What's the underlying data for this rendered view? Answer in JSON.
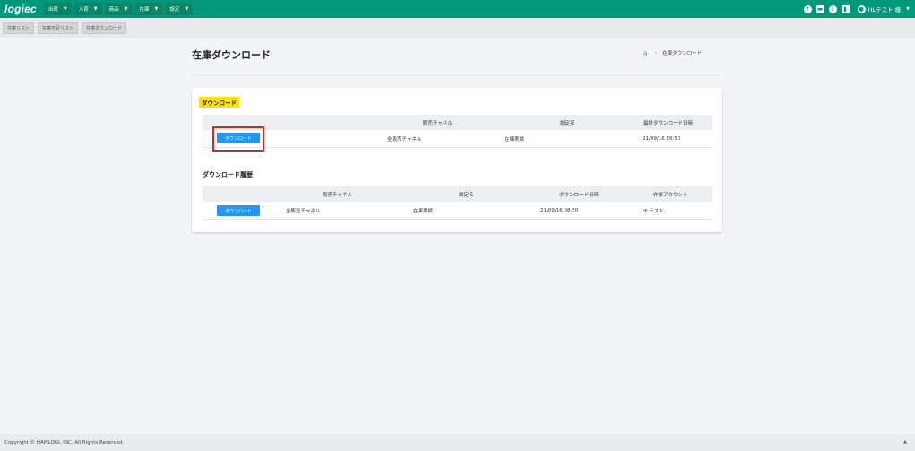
{
  "app": {
    "logo": "logiec"
  },
  "nav": {
    "menus": [
      {
        "label": "出荷"
      },
      {
        "label": "入荷"
      },
      {
        "label": "商品"
      },
      {
        "label": "在庫"
      },
      {
        "label": "設定"
      }
    ],
    "user_label": "HLテスト 様"
  },
  "subtabs": [
    "在庫リスト",
    "在庫不足リスト",
    "在庫ダウンロード"
  ],
  "page": {
    "title": "在庫ダウンロード",
    "breadcrumb_current": "在庫ダウンロード"
  },
  "download_section": {
    "badge": "ダウンロード",
    "headers": [
      "販売チャネル",
      "設定名",
      "最終ダウンロード日時"
    ],
    "rows": [
      {
        "button": "ダウンロード",
        "channel": "全販売チャネル",
        "setting": "在庫実績",
        "last_download": "21/09/16 08:50"
      }
    ]
  },
  "history_section": {
    "title": "ダウンロード履歴",
    "headers": [
      "販売チャネル",
      "設定名",
      "ダウンロード日時",
      "作業アカウント"
    ],
    "rows": [
      {
        "button": "ダウンロード",
        "channel": "全販売チャネル",
        "setting": "在庫実績",
        "downloaded_at": "21/09/16 08:50",
        "account": "HLテスト"
      }
    ]
  },
  "footer": {
    "copyright": "Copyright © HAPILOGI, INC. All Rights Reserved."
  },
  "colors": {
    "primary_green": "#00977a",
    "button_blue": "#2196f3",
    "badge_yellow": "#ffe400",
    "highlight_red": "#e01f1f"
  }
}
